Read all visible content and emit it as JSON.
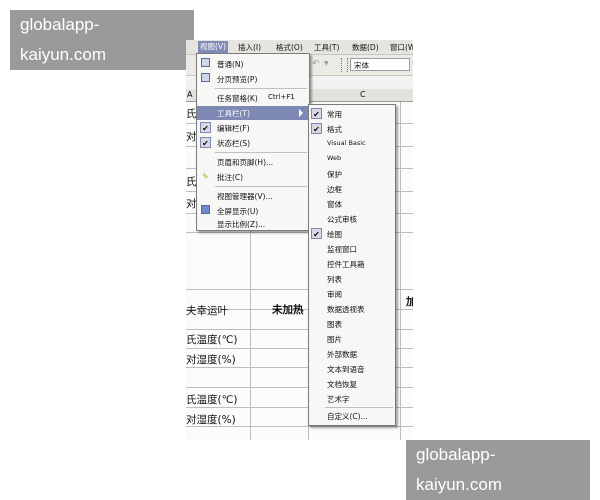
{
  "watermark": {
    "top": "globalapp-kaiyun.com",
    "bottom": "globalapp-kaiyun.com"
  },
  "menubar": {
    "items": [
      "视图(V)",
      "插入(I)",
      "格式(O)",
      "工具(T)",
      "数据(D)",
      "窗口(W)"
    ]
  },
  "toolbar": {
    "font_name": "宋体",
    "undo_icon": "undo-icon"
  },
  "columns": {
    "a": "A",
    "c": "C"
  },
  "sheet": {
    "left_fragments": [
      "氏温",
      "对湿",
      "氏温",
      "对湿"
    ],
    "row_label_a": "夫幸运叶",
    "row_value_a": "未加热",
    "row_value_a_cut": "加",
    "temp_label_1": "氏温度(℃)",
    "hum_label_1": "对湿度(%)",
    "temp_label_2": "氏温度(℃)",
    "hum_label_2": "对湿度(%)"
  },
  "view_menu": {
    "items": [
      {
        "label": "普通(N)",
        "icon": "normal-view-icon"
      },
      {
        "label": "分页预览(P)",
        "icon": "page-break-preview-icon"
      },
      {
        "label": "任务窗格(K)",
        "shortcut": "Ctrl+F1"
      },
      {
        "label": "工具栏(T)",
        "selected": true,
        "submenu": true
      },
      {
        "label": "编辑栏(F)",
        "checked": true
      },
      {
        "label": "状态栏(S)",
        "checked": true
      },
      {
        "label": "页眉和页脚(H)..."
      },
      {
        "label": "批注(C)",
        "icon": "comment-icon"
      },
      {
        "label": "视图管理器(V)..."
      },
      {
        "label": "全屏显示(U)",
        "icon": "full-screen-icon"
      },
      {
        "label": "显示比例(Z)..."
      }
    ]
  },
  "toolbar_menu": {
    "items": [
      {
        "label": "常用",
        "checked": true
      },
      {
        "label": "格式",
        "checked": true
      },
      {
        "label": "Visual Basic"
      },
      {
        "label": "Web"
      },
      {
        "label": "保护"
      },
      {
        "label": "边框"
      },
      {
        "label": "窗体"
      },
      {
        "label": "公式审核"
      },
      {
        "label": "绘图",
        "checked": true
      },
      {
        "label": "监视窗口"
      },
      {
        "label": "控件工具箱"
      },
      {
        "label": "列表"
      },
      {
        "label": "审阅"
      },
      {
        "label": "数据透视表"
      },
      {
        "label": "图表"
      },
      {
        "label": "图片"
      },
      {
        "label": "外部数据"
      },
      {
        "label": "文本到语音"
      },
      {
        "label": "文档恢复"
      },
      {
        "label": "艺术字"
      },
      {
        "label": "自定义(C)..."
      }
    ]
  }
}
